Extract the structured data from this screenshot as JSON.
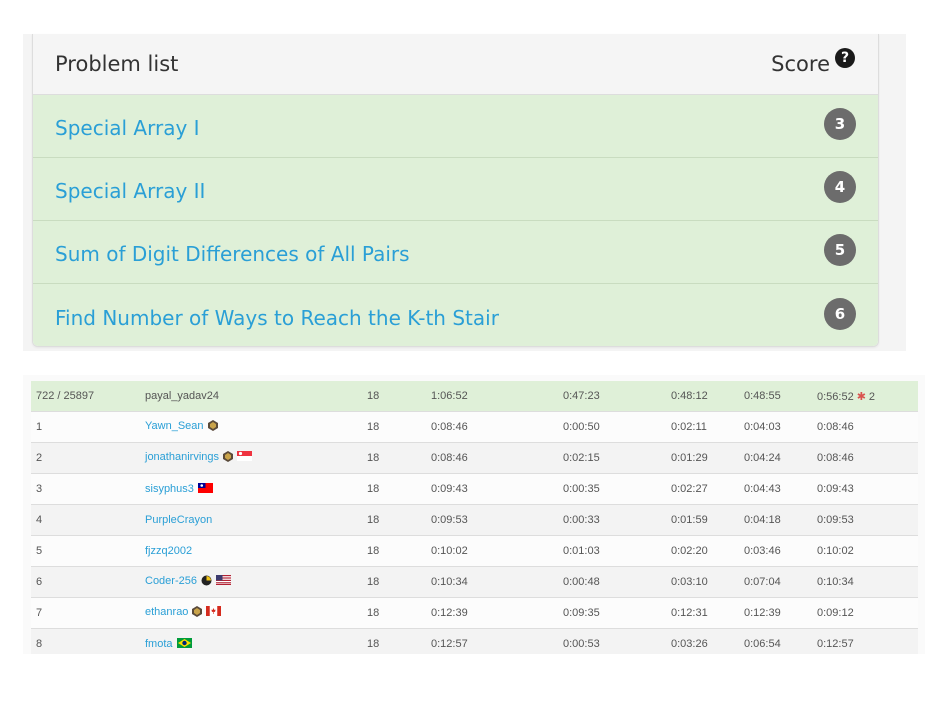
{
  "problem_list": {
    "title": "Problem list",
    "score_label": "Score",
    "problems": [
      {
        "name": "Special Array I",
        "score": "3"
      },
      {
        "name": "Special Array II",
        "score": "4"
      },
      {
        "name": "Sum of Digit Differences of All Pairs",
        "score": "5"
      },
      {
        "name": "Find Number of Ways to Reach the K-th Stair",
        "score": "6"
      }
    ]
  },
  "ranking": {
    "rows": [
      {
        "rank": "722 / 25897",
        "user": "payal_yadav24",
        "score": "18",
        "finish": "1:06:52",
        "q1": "0:47:23",
        "q2": "0:48:12",
        "q3": "0:48:55",
        "q4": "0:56:52",
        "q4_bugs": "2",
        "badges": [],
        "flag": ""
      },
      {
        "rank": "1",
        "user": "Yawn_Sean",
        "score": "18",
        "finish": "0:08:46",
        "q1": "0:00:50",
        "q2": "0:02:11",
        "q3": "0:04:03",
        "q4": "0:08:46",
        "q4_bugs": "",
        "badges": [
          "guardian-badge-icon"
        ],
        "flag": ""
      },
      {
        "rank": "2",
        "user": "jonathanirvings",
        "score": "18",
        "finish": "0:08:46",
        "q1": "0:02:15",
        "q2": "0:01:29",
        "q3": "0:04:24",
        "q4": "0:08:46",
        "q4_bugs": "",
        "badges": [
          "guardian-badge-icon"
        ],
        "flag": "singapore"
      },
      {
        "rank": "3",
        "user": "sisyphus3",
        "score": "18",
        "finish": "0:09:43",
        "q1": "0:00:35",
        "q2": "0:02:27",
        "q3": "0:04:43",
        "q4": "0:09:43",
        "q4_bugs": "",
        "badges": [],
        "flag": "taiwan"
      },
      {
        "rank": "4",
        "user": "PurpleCrayon",
        "score": "18",
        "finish": "0:09:53",
        "q1": "0:00:33",
        "q2": "0:01:59",
        "q3": "0:04:18",
        "q4": "0:09:53",
        "q4_bugs": "",
        "badges": [],
        "flag": ""
      },
      {
        "rank": "5",
        "user": "fjzzq2002",
        "score": "18",
        "finish": "0:10:02",
        "q1": "0:01:03",
        "q2": "0:02:20",
        "q3": "0:03:46",
        "q4": "0:10:02",
        "q4_bugs": "",
        "badges": [],
        "flag": ""
      },
      {
        "rank": "6",
        "user": "Coder-256",
        "score": "18",
        "finish": "0:10:34",
        "q1": "0:00:48",
        "q2": "0:03:10",
        "q3": "0:07:04",
        "q4": "0:10:34",
        "q4_bugs": "",
        "badges": [
          "knight-badge-icon"
        ],
        "flag": "usa"
      },
      {
        "rank": "7",
        "user": "ethanrao",
        "score": "18",
        "finish": "0:12:39",
        "q1": "0:09:35",
        "q2": "0:12:31",
        "q3": "0:12:39",
        "q4": "0:09:12",
        "q4_bugs": "",
        "badges": [
          "guardian-badge-icon"
        ],
        "flag": "canada"
      },
      {
        "rank": "8",
        "user": "fmota",
        "score": "18",
        "finish": "0:12:57",
        "q1": "0:00:53",
        "q2": "0:03:26",
        "q3": "0:06:54",
        "q4": "0:12:57",
        "q4_bugs": "",
        "badges": [],
        "flag": "brazil"
      }
    ]
  },
  "colors": {
    "accent_link": "#2a9fd6",
    "accepted_row": "#dff0d8",
    "badge_gray": "#6c6c6c",
    "bug_red": "#d9534f"
  }
}
